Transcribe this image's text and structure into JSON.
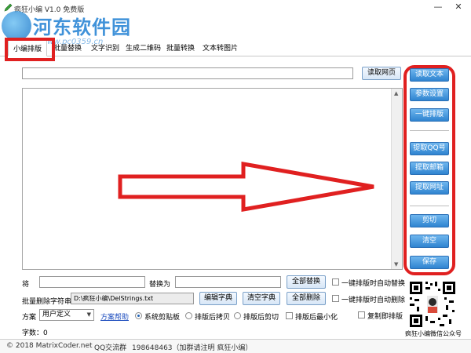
{
  "window": {
    "title": "疯狂小编 V1.0 免费版",
    "minimize_glyph": "—",
    "close_glyph": "✕"
  },
  "watermark": {
    "title": "河东软件园",
    "url": "www.pc0359.cn"
  },
  "tabs": [
    {
      "label": "小编排版",
      "active": true
    },
    {
      "label": "批量替换"
    },
    {
      "label": "文字识别"
    },
    {
      "label": "生成二维码"
    },
    {
      "label": "批量转换"
    },
    {
      "label": "文本转图片"
    }
  ],
  "toolbar": {
    "read_web_label": "读取网页",
    "url_value": ""
  },
  "editor": {
    "content": "",
    "scroll_up": "▲",
    "scroll_down": "▼"
  },
  "side_buttons": {
    "read_text": "读取文本",
    "settings": "参数设置",
    "one_click_format": "一键排版",
    "extract_qq": "提取QQ号",
    "extract_email": "提取邮箱",
    "extract_url": "提取网址",
    "cut": "剪切",
    "clear": "清空",
    "save": "保存"
  },
  "replace_row": {
    "from_label": "将",
    "from_value": "",
    "to_label": "替换为",
    "to_value": "",
    "replace_all_button": "全部替换",
    "auto_replace_label": "一键排版时自动替换"
  },
  "delete_row": {
    "label": "批量删除字符串",
    "path_value": "D:\\疯狂小编\\DelStrings.txt",
    "edit_dict_button": "编辑字典",
    "clear_dict_button": "清空字典",
    "delete_all_button": "全部删除",
    "auto_delete_label": "一键排版时自动删除"
  },
  "scheme_row": {
    "label": "方案",
    "selected": "用户定义",
    "caret": "▼",
    "help_link": "方案帮助",
    "radios": [
      {
        "label": "系统剪贴板",
        "checked": true
      },
      {
        "label": "排版后拷贝",
        "checked": false
      },
      {
        "label": "排版后剪切",
        "checked": false
      }
    ],
    "minimize_label": "排版后最小化",
    "copy_label": "复制即排版"
  },
  "word_count": "字数：0",
  "qr": {
    "caption": "疯狂小编微信公众号"
  },
  "statusbar": {
    "copyright": "© 2018 MatrixCoder.net",
    "qq_group_label": "QQ交流群",
    "qq_group_value": "198648463（加群请注明  疯狂小编）"
  },
  "colors": {
    "accent_blue": "#2f84d0",
    "highlight_red": "#e02020",
    "watermark_blue": "#1f7fd3"
  }
}
